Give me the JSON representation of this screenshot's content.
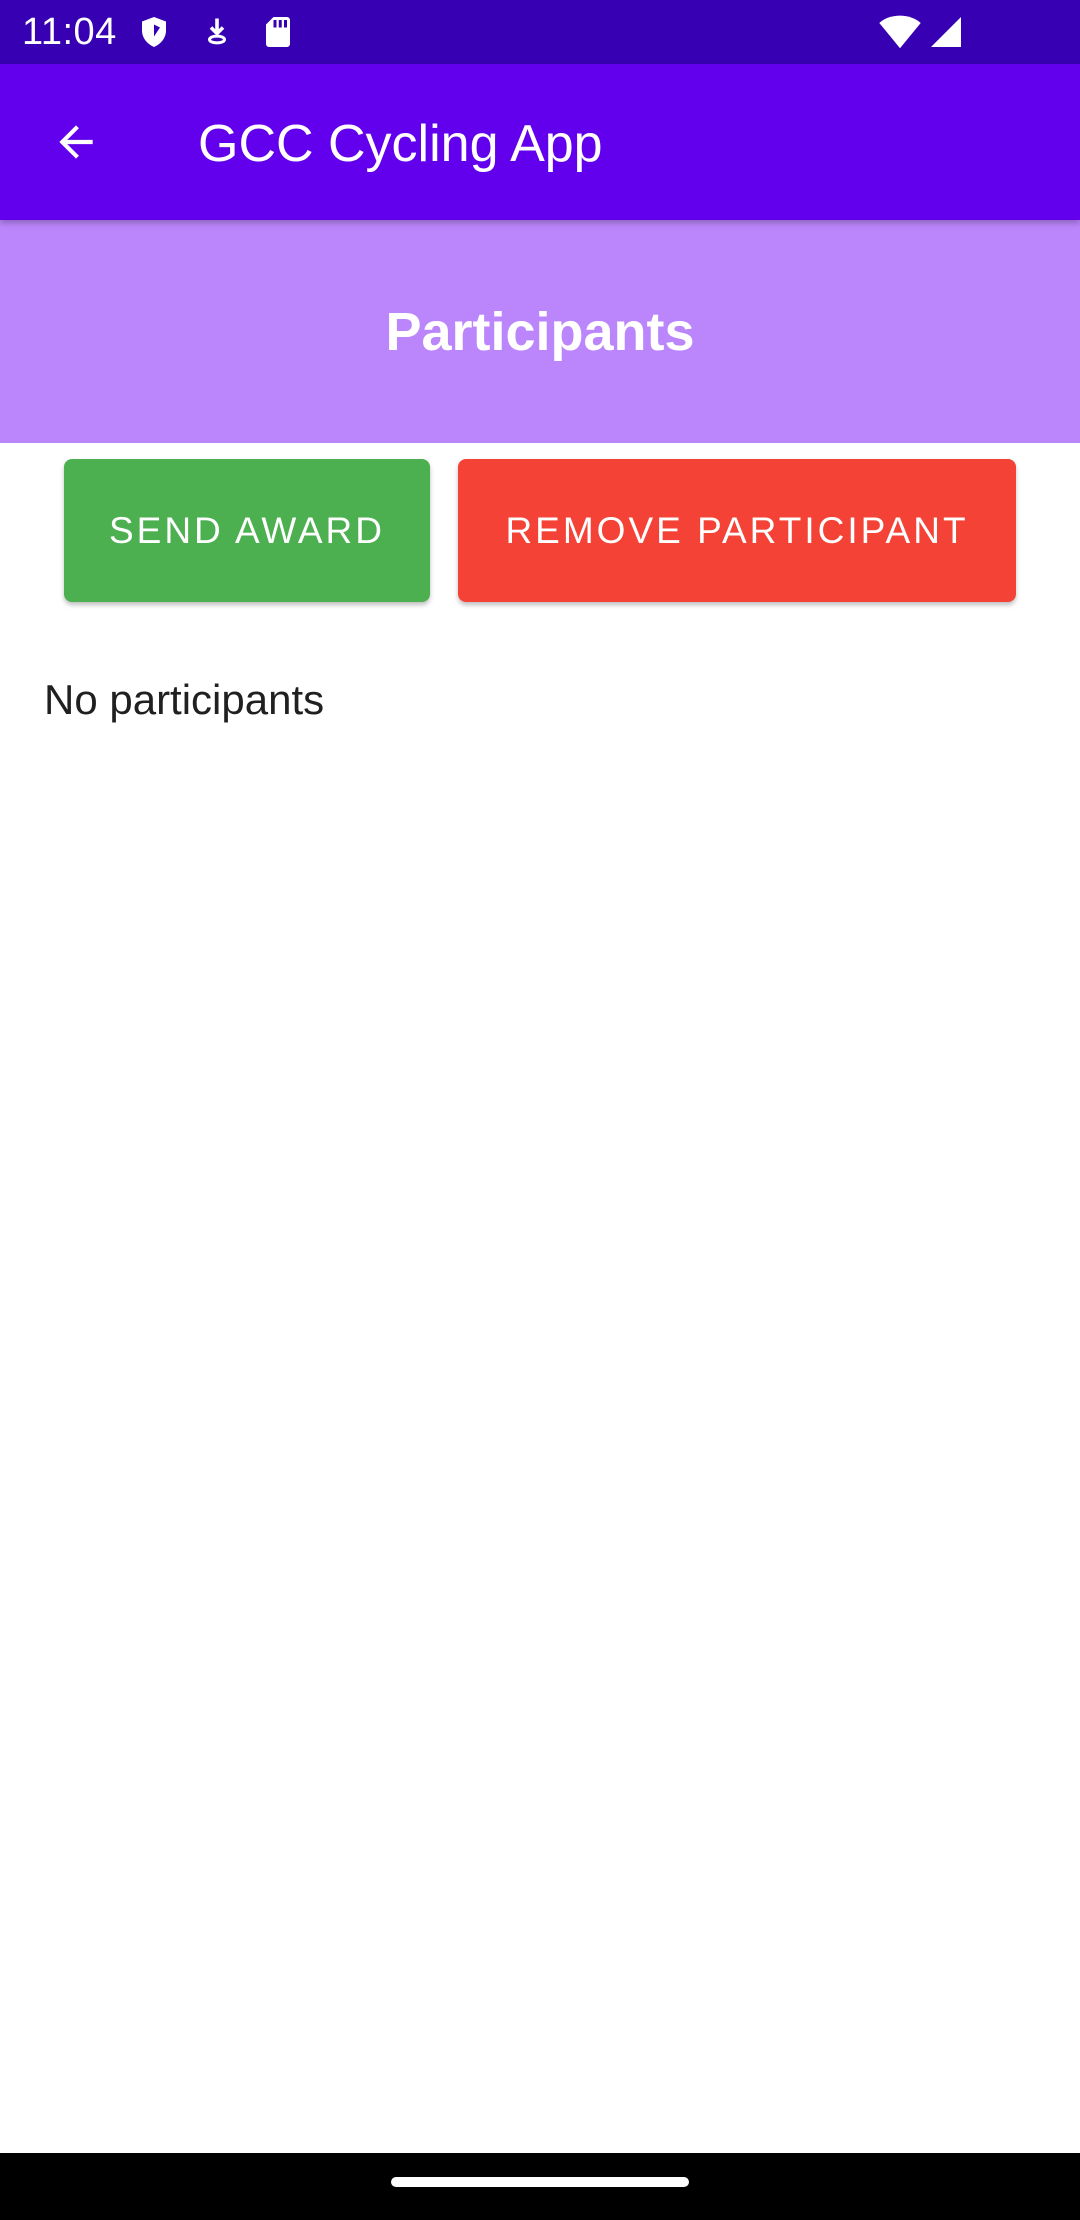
{
  "status_bar": {
    "time": "11:04",
    "icons": [
      "shield-icon",
      "download-icon",
      "sd-card-icon",
      "wifi-icon",
      "cell-signal-icon"
    ]
  },
  "app_bar": {
    "title": "GCC Cycling App",
    "back_icon": "arrow-left-icon",
    "color": "#6200ee"
  },
  "header": {
    "title": "Participants",
    "color": "#bb86fc"
  },
  "actions": {
    "send_award_label": "SEND AWARD",
    "send_award_color": "#4caf50",
    "remove_participant_label": "REMOVE PARTICIPANT",
    "remove_participant_color": "#f44336"
  },
  "participants": {
    "empty_message": "No participants",
    "items": []
  }
}
